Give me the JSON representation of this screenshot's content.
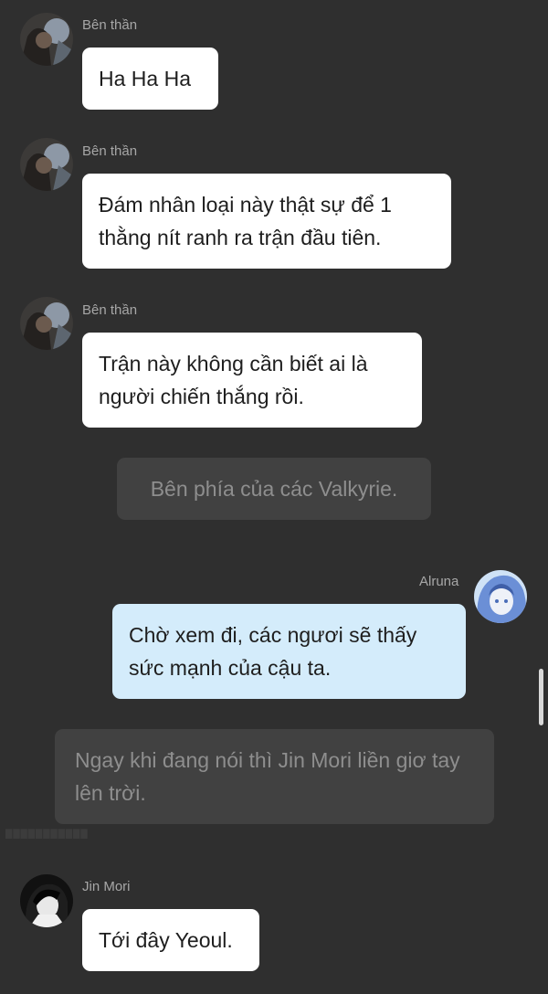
{
  "colors": {
    "background": "#2f2f2f",
    "bubble_white": "#ffffff",
    "bubble_blue": "#d4ecfb",
    "narration_box": "#414141",
    "name_text": "#a7a7a7"
  },
  "messages": [
    {
      "type": "incoming",
      "sender": "Bên thần",
      "avatar": "dark-portrait-avatar",
      "text": "Ha Ha Ha"
    },
    {
      "type": "incoming",
      "sender": "Bên thần",
      "avatar": "dark-portrait-avatar",
      "text": "Đám nhân loại này thật sự để 1 thằng nít ranh ra trận đầu tiên."
    },
    {
      "type": "incoming",
      "sender": "Bên thần",
      "avatar": "dark-portrait-avatar",
      "text": "Trận này không cần biết ai là người chiến thắng rồi."
    },
    {
      "type": "narration",
      "text": "Bên phía của các Valkyrie."
    },
    {
      "type": "outgoing",
      "sender": "Alruna",
      "avatar": "blue-hair-avatar",
      "text": "Chờ xem đi, các ngươi sẽ thấy sức mạnh của cậu ta."
    },
    {
      "type": "narration",
      "text": "Ngay khi đang nói thì Jin Mori liền giơ tay lên trời."
    },
    {
      "type": "incoming",
      "sender": "Jin Mori",
      "avatar": "black-white-avatar",
      "text": "Tới đây Yeoul."
    }
  ]
}
